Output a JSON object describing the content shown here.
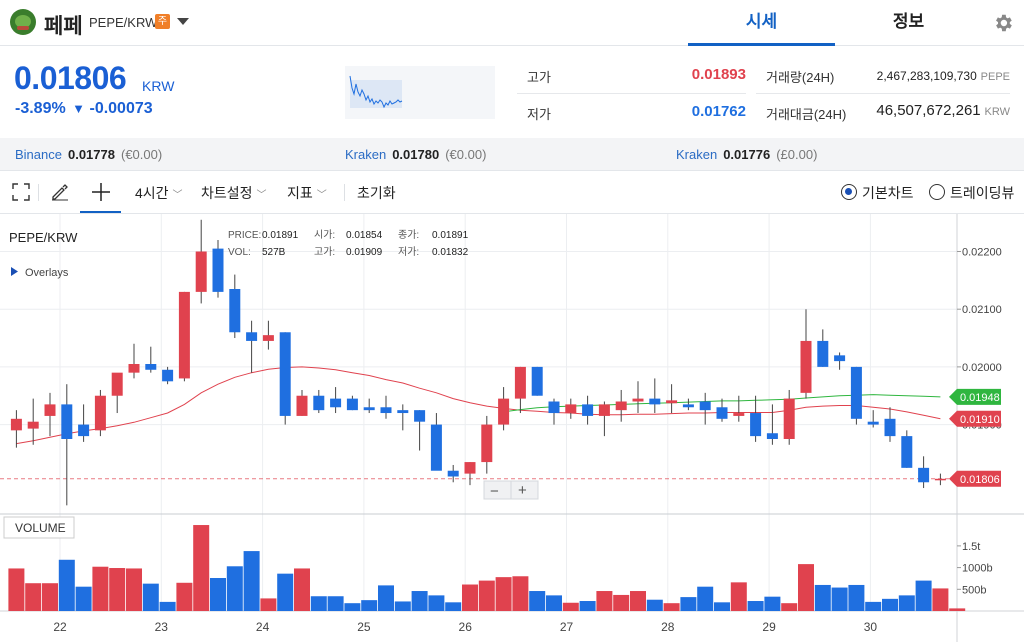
{
  "header": {
    "coin_name": "페페",
    "pair": "PEPE/KRW",
    "badge": "주",
    "tabs": [
      {
        "label": "시세"
      },
      {
        "label": "정보"
      }
    ]
  },
  "ticker": {
    "price": "0.01806",
    "currency": "KRW",
    "change_pct": "-3.89%",
    "change_arrow": "▼",
    "change_abs": "-0.00073",
    "high_label": "고가",
    "high_value": "0.01893",
    "low_label": "저가",
    "low_value": "0.01762",
    "volume_label": "거래량(24H)",
    "volume_value": "2,467,283,109,730",
    "volume_unit": "PEPE",
    "amount_label": "거래대금(24H)",
    "amount_value": "46,507,672,261",
    "amount_unit": "KRW"
  },
  "exchanges": [
    {
      "name": "Binance",
      "price": "0.01778",
      "diff": "(€0.00)"
    },
    {
      "name": "Kraken",
      "price": "0.01780",
      "diff": "(€0.00)"
    },
    {
      "name": "Kraken",
      "price": "0.01776",
      "diff": "(£0.00)"
    }
  ],
  "toolbar": {
    "interval": "4시간",
    "chart_settings": "차트설정",
    "indicators": "지표",
    "reset": "초기화",
    "basic_chart": "기본차트",
    "tradingview": "트레이딩뷰"
  },
  "legend": {
    "symbol": "PEPE/KRW",
    "overlays": "Overlays",
    "price_label": "PRICE:",
    "price_value": "0.01891",
    "open_label": "시가:",
    "open_value": "0.01854",
    "close_label": "종가:",
    "close_value": "0.01891",
    "vol_label": "VOL:",
    "vol_value": "527B",
    "high_label": "고가:",
    "high_value": "0.01909",
    "low_label": "저가:",
    "low_value": "0.01832",
    "volume_panel": "VOLUME",
    "zoom_out": "−",
    "zoom_in": "+"
  },
  "colors": {
    "up": "#e0424e",
    "down": "#1f6fe0",
    "accent": "#1261c4",
    "ma_red": "#e0424e",
    "ma_green": "#2fb63f"
  },
  "chart_data": {
    "type": "candlestick",
    "price_axis": {
      "ticks": [
        "0.02200",
        "0.02100",
        "0.02000",
        "0.01900"
      ],
      "range": [
        0.01745,
        0.02265
      ]
    },
    "price_tags": [
      {
        "value": "0.01948",
        "color": "#2fb63f"
      },
      {
        "value": "0.01910",
        "color": "#e0424e"
      },
      {
        "value": "0.01806",
        "color": "#e0424e"
      }
    ],
    "volume_axis": {
      "ticks": [
        "1.5t",
        "1000b",
        "500b"
      ],
      "values": [
        1500,
        1000,
        500
      ],
      "max": 2050
    },
    "x_labels": [
      "22",
      "23",
      "24",
      "25",
      "26",
      "27",
      "28",
      "29",
      "30"
    ],
    "candles": [
      {
        "o": 0.0189,
        "h": 0.01925,
        "l": 0.0186,
        "c": 0.0191
      },
      {
        "o": 0.01893,
        "h": 0.01945,
        "l": 0.01865,
        "c": 0.01905
      },
      {
        "o": 0.01915,
        "h": 0.01955,
        "l": 0.0188,
        "c": 0.01935
      },
      {
        "o": 0.01935,
        "h": 0.0197,
        "l": 0.0176,
        "c": 0.01875
      },
      {
        "o": 0.019,
        "h": 0.01935,
        "l": 0.0187,
        "c": 0.0188
      },
      {
        "o": 0.0189,
        "h": 0.0196,
        "l": 0.0188,
        "c": 0.0195
      },
      {
        "o": 0.0195,
        "h": 0.01985,
        "l": 0.0192,
        "c": 0.0199
      },
      {
        "o": 0.0199,
        "h": 0.0204,
        "l": 0.0198,
        "c": 0.02005
      },
      {
        "o": 0.02005,
        "h": 0.02035,
        "l": 0.0199,
        "c": 0.01995
      },
      {
        "o": 0.01995,
        "h": 0.02,
        "l": 0.0197,
        "c": 0.01975
      },
      {
        "o": 0.0198,
        "h": 0.0213,
        "l": 0.01975,
        "c": 0.0213
      },
      {
        "o": 0.0213,
        "h": 0.02255,
        "l": 0.0211,
        "c": 0.022
      },
      {
        "o": 0.02205,
        "h": 0.0222,
        "l": 0.0212,
        "c": 0.0213
      },
      {
        "o": 0.02135,
        "h": 0.0216,
        "l": 0.0205,
        "c": 0.0206
      },
      {
        "o": 0.0206,
        "h": 0.0208,
        "l": 0.0199,
        "c": 0.02045
      },
      {
        "o": 0.02045,
        "h": 0.0208,
        "l": 0.0203,
        "c": 0.02055
      },
      {
        "o": 0.0206,
        "h": 0.0206,
        "l": 0.019,
        "c": 0.01915
      },
      {
        "o": 0.01915,
        "h": 0.0196,
        "l": 0.01915,
        "c": 0.0195
      },
      {
        "o": 0.0195,
        "h": 0.0196,
        "l": 0.0192,
        "c": 0.01925
      },
      {
        "o": 0.01945,
        "h": 0.01965,
        "l": 0.0192,
        "c": 0.0193
      },
      {
        "o": 0.01945,
        "h": 0.0195,
        "l": 0.01925,
        "c": 0.01925
      },
      {
        "o": 0.0193,
        "h": 0.01945,
        "l": 0.0192,
        "c": 0.01925
      },
      {
        "o": 0.0193,
        "h": 0.0195,
        "l": 0.0191,
        "c": 0.0192
      },
      {
        "o": 0.01925,
        "h": 0.01935,
        "l": 0.0189,
        "c": 0.0192
      },
      {
        "o": 0.01925,
        "h": 0.01925,
        "l": 0.01855,
        "c": 0.01905
      },
      {
        "o": 0.019,
        "h": 0.0192,
        "l": 0.0184,
        "c": 0.0182
      },
      {
        "o": 0.0182,
        "h": 0.0183,
        "l": 0.018,
        "c": 0.0181
      },
      {
        "o": 0.01815,
        "h": 0.01835,
        "l": 0.01795,
        "c": 0.01835
      },
      {
        "o": 0.01835,
        "h": 0.01915,
        "l": 0.01815,
        "c": 0.019
      },
      {
        "o": 0.019,
        "h": 0.01965,
        "l": 0.0189,
        "c": 0.01945
      },
      {
        "o": 0.01945,
        "h": 0.02,
        "l": 0.0192,
        "c": 0.02
      },
      {
        "o": 0.02,
        "h": 0.02,
        "l": 0.0195,
        "c": 0.0195
      },
      {
        "o": 0.0194,
        "h": 0.01945,
        "l": 0.019,
        "c": 0.0192
      },
      {
        "o": 0.0192,
        "h": 0.01945,
        "l": 0.0191,
        "c": 0.01935
      },
      {
        "o": 0.01935,
        "h": 0.0195,
        "l": 0.019,
        "c": 0.01915
      },
      {
        "o": 0.01915,
        "h": 0.0194,
        "l": 0.0188,
        "c": 0.01935
      },
      {
        "o": 0.01925,
        "h": 0.0196,
        "l": 0.01905,
        "c": 0.0194
      },
      {
        "o": 0.0194,
        "h": 0.01975,
        "l": 0.0192,
        "c": 0.01945
      },
      {
        "o": 0.01945,
        "h": 0.0198,
        "l": 0.0192,
        "c": 0.01935
      },
      {
        "o": 0.01937,
        "h": 0.0197,
        "l": 0.0192,
        "c": 0.01942
      },
      {
        "o": 0.01935,
        "h": 0.01945,
        "l": 0.01925,
        "c": 0.0193
      },
      {
        "o": 0.0194,
        "h": 0.01955,
        "l": 0.019,
        "c": 0.01925
      },
      {
        "o": 0.0193,
        "h": 0.01945,
        "l": 0.01905,
        "c": 0.0191
      },
      {
        "o": 0.01915,
        "h": 0.0195,
        "l": 0.01905,
        "c": 0.0192
      },
      {
        "o": 0.0192,
        "h": 0.0195,
        "l": 0.0187,
        "c": 0.0188
      },
      {
        "o": 0.01885,
        "h": 0.01935,
        "l": 0.01865,
        "c": 0.01875
      },
      {
        "o": 0.01875,
        "h": 0.0196,
        "l": 0.01865,
        "c": 0.01945
      },
      {
        "o": 0.01955,
        "h": 0.021,
        "l": 0.01945,
        "c": 0.02045
      },
      {
        "o": 0.02045,
        "h": 0.02065,
        "l": 0.02,
        "c": 0.02
      },
      {
        "o": 0.0202,
        "h": 0.02025,
        "l": 0.01995,
        "c": 0.0201
      },
      {
        "o": 0.02,
        "h": 0.02,
        "l": 0.019,
        "c": 0.0191
      },
      {
        "o": 0.01905,
        "h": 0.01925,
        "l": 0.01895,
        "c": 0.019
      },
      {
        "o": 0.0191,
        "h": 0.0193,
        "l": 0.0187,
        "c": 0.0188
      },
      {
        "o": 0.0188,
        "h": 0.0189,
        "l": 0.01825,
        "c": 0.01825
      },
      {
        "o": 0.01825,
        "h": 0.01845,
        "l": 0.0179,
        "c": 0.018
      },
      {
        "o": 0.01805,
        "h": 0.01815,
        "l": 0.01795,
        "c": 0.01806
      }
    ],
    "volumes": [
      980,
      640,
      640,
      1180,
      560,
      1020,
      990,
      980,
      630,
      210,
      650,
      1980,
      760,
      1030,
      1380,
      290,
      860,
      980,
      340,
      340,
      180,
      250,
      590,
      220,
      460,
      360,
      200,
      610,
      700,
      780,
      800,
      460,
      360,
      190,
      230,
      460,
      370,
      460,
      260,
      180,
      320,
      560,
      200,
      660,
      230,
      330,
      180,
      1080,
      600,
      540,
      600,
      210,
      280,
      360,
      700,
      520,
      60
    ],
    "ma_red": [
      0.01867,
      0.01872,
      0.01878,
      0.01884,
      0.01889,
      0.01893,
      0.01898,
      0.01904,
      0.01912,
      0.0192,
      0.01935,
      0.01955,
      0.0197,
      0.01982,
      0.0199,
      0.01996,
      0.01999,
      0.02,
      0.01998,
      0.01995,
      0.0199,
      0.01985,
      0.01978,
      0.01972,
      0.01963,
      0.01955,
      0.01945,
      0.01938,
      0.01932,
      0.01928,
      0.01925,
      0.01923,
      0.01921,
      0.0192,
      0.01918,
      0.01917,
      0.01917,
      0.01918,
      0.01918,
      0.01919,
      0.0192,
      0.0192,
      0.01921,
      0.01921,
      0.01921,
      0.01921,
      0.01925,
      0.0193,
      0.01932,
      0.01933,
      0.01933,
      0.0193,
      0.01927,
      0.01922,
      0.01916,
      0.0191
    ],
    "ma_green": [
      null,
      null,
      null,
      null,
      null,
      null,
      null,
      null,
      null,
      null,
      null,
      null,
      null,
      null,
      null,
      null,
      null,
      null,
      null,
      null,
      null,
      null,
      null,
      null,
      null,
      null,
      null,
      null,
      null,
      0.01922,
      0.01926,
      0.01929,
      0.01931,
      0.01932,
      0.01933,
      0.01934,
      0.01935,
      0.01936,
      0.01937,
      0.01938,
      0.01939,
      0.0194,
      0.01941,
      0.01941,
      0.01942,
      0.01943,
      0.01944,
      0.01946,
      0.01948,
      0.0195,
      0.01951,
      0.01952,
      0.01951,
      0.0195,
      0.01949,
      0.01948
    ]
  }
}
